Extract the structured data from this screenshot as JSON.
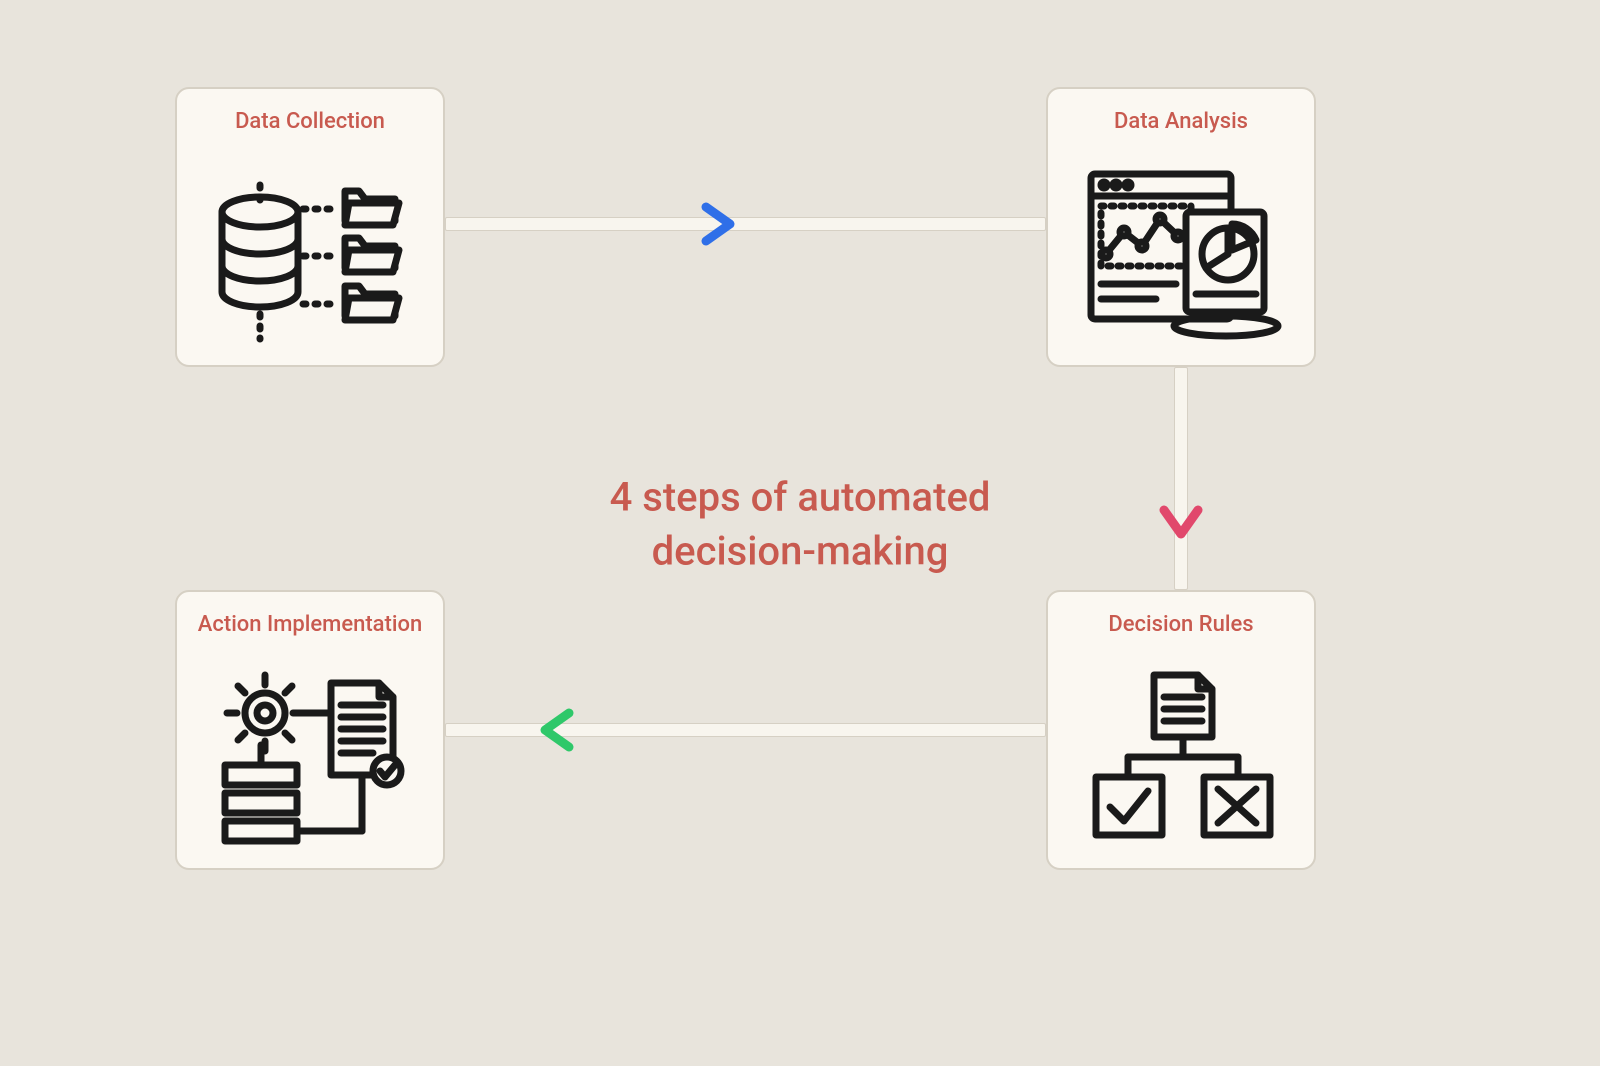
{
  "title_line1": "4 steps of automated",
  "title_line2": "decision-making",
  "steps": [
    {
      "label": "Data Collection",
      "icon": "data-collection-icon"
    },
    {
      "label": "Data Analysis",
      "icon": "data-analysis-icon"
    },
    {
      "label": "Decision Rules",
      "icon": "decision-rules-icon"
    },
    {
      "label": "Action Implementation",
      "icon": "action-implementation-icon"
    }
  ],
  "arrows": [
    {
      "from": "Data Collection",
      "to": "Data Analysis",
      "color": "#2f6fe8"
    },
    {
      "from": "Data Analysis",
      "to": "Decision Rules",
      "color": "#e1486c"
    },
    {
      "from": "Decision Rules",
      "to": "Action Implementation",
      "color": "#2fc86a"
    }
  ],
  "colors": {
    "background": "#e8e4dc",
    "card_bg": "#fbf8f2",
    "card_border": "#d6d0c4",
    "accent": "#c85a4f",
    "icon_stroke": "#1a1a1a"
  }
}
